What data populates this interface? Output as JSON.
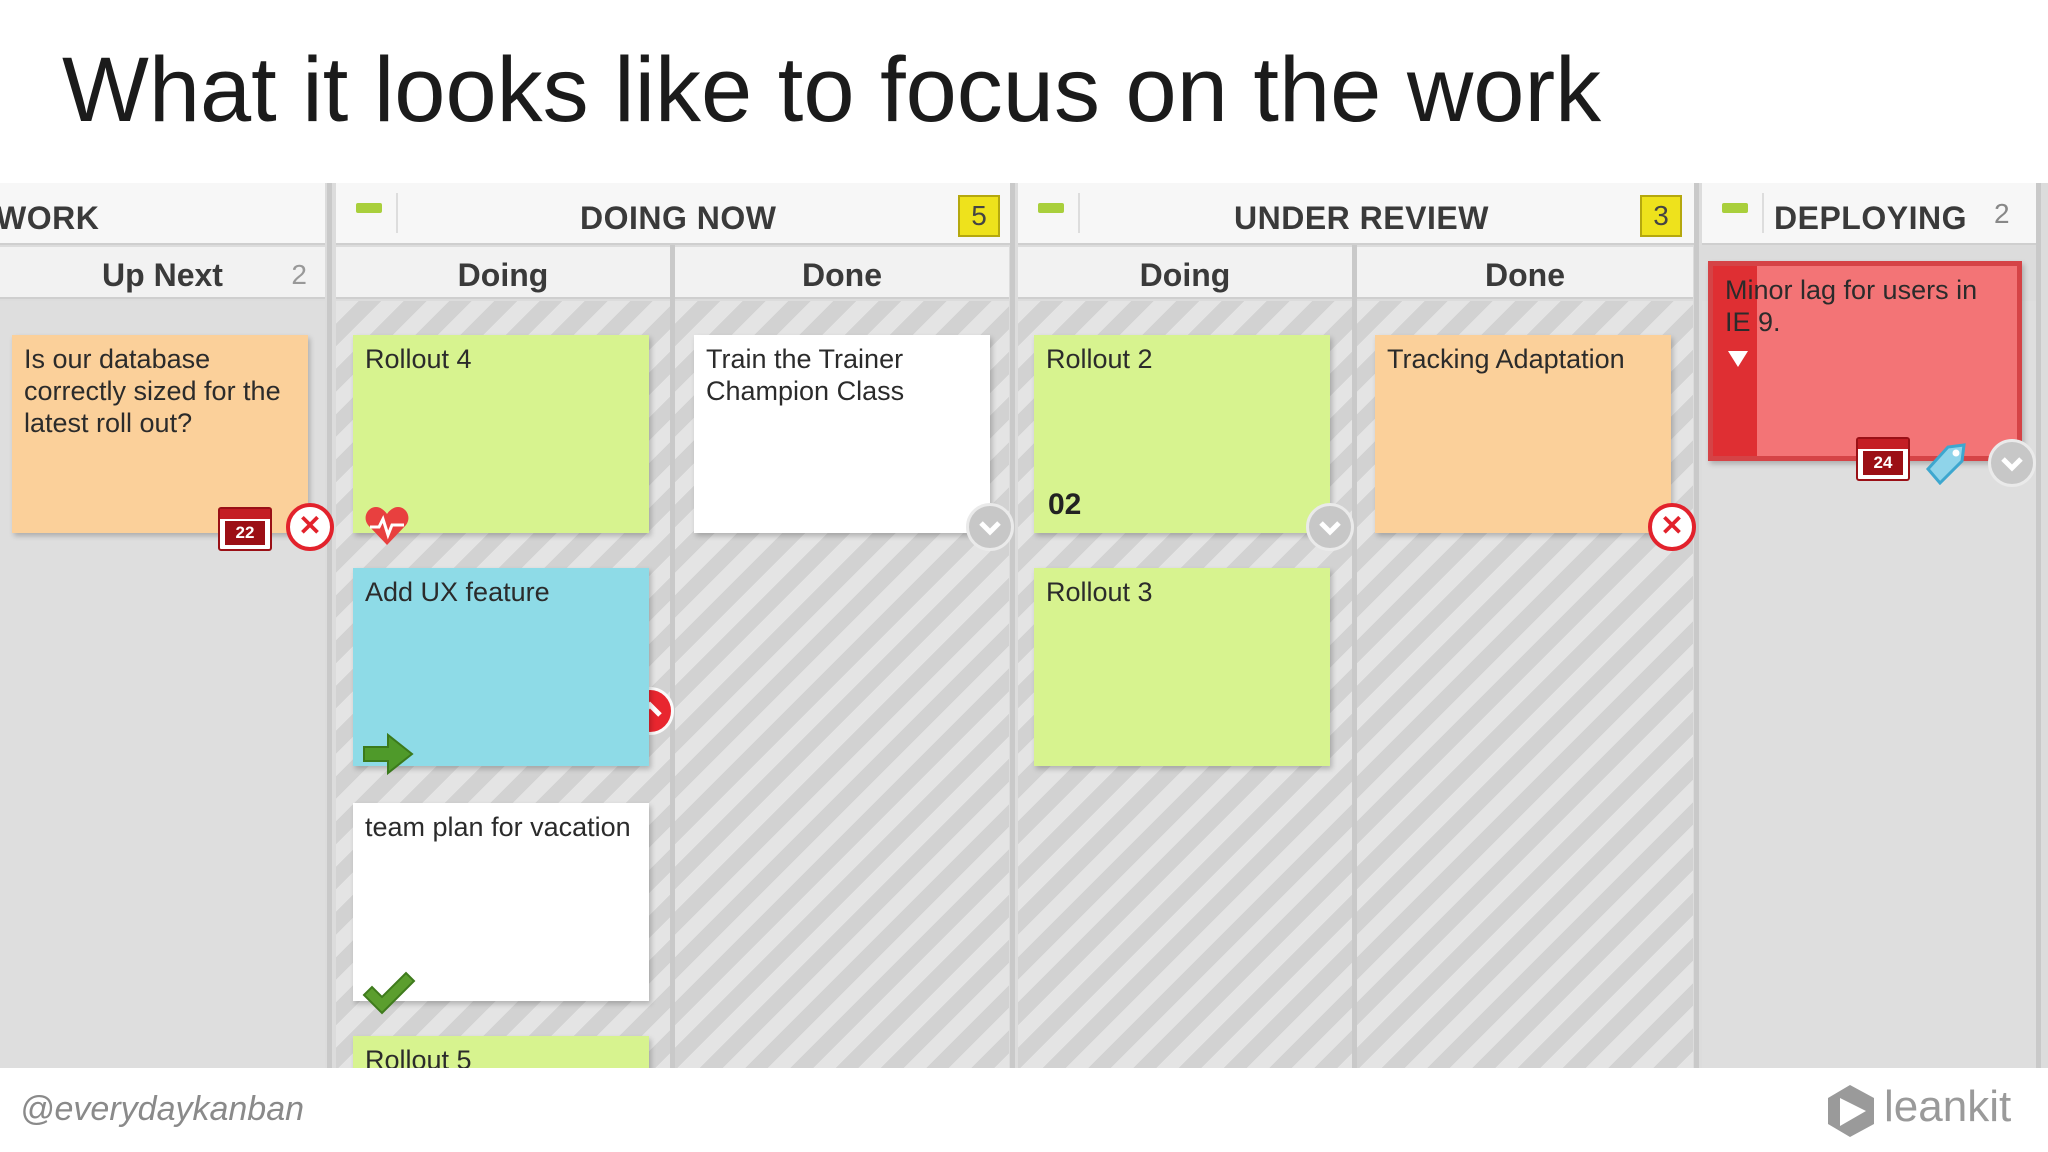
{
  "slide": {
    "title": "What it looks like to focus on the work"
  },
  "lanes": [
    {
      "title": "WORK",
      "wip": ""
    },
    {
      "title": "DOING NOW",
      "wip": "5"
    },
    {
      "title": "UNDER REVIEW",
      "wip": "3"
    },
    {
      "title": "DEPLOYING",
      "wip": "2"
    }
  ],
  "columns": [
    {
      "title": "Up Next",
      "count": "2"
    },
    {
      "title": "Doing",
      "count": ""
    },
    {
      "title": "Done",
      "count": ""
    },
    {
      "title": "Doing",
      "count": ""
    },
    {
      "title": "Done",
      "count": ""
    }
  ],
  "cards": {
    "database": {
      "text": "Is our database correctly sized for the latest roll out?",
      "date": "22",
      "color": "#fbd09a"
    },
    "rollout4": {
      "text": "Rollout 4",
      "color": "#d7f38f",
      "icons": [
        "heart-icon",
        "tag-icon",
        "chevron-up-icon"
      ]
    },
    "ux": {
      "text": "Add UX feature",
      "color": "#8edbe7",
      "icons": [
        "arrow-right-icon"
      ]
    },
    "vacation": {
      "text": "team plan for vacation",
      "color": "#ffffff",
      "icons": [
        "checkmark-icon"
      ]
    },
    "rollout5": {
      "text": "Rollout 5",
      "color": "#d7f38f"
    },
    "trainer": {
      "text": "Train the Trainer Champion Class",
      "color": "#ffffff"
    },
    "rollout2": {
      "text": "Rollout 2",
      "number": "02",
      "color": "#d7f38f"
    },
    "rollout3": {
      "text": "Rollout 3",
      "color": "#d7f38f"
    },
    "tracking": {
      "text": "Tracking Adaptation",
      "color": "#fbd09a"
    },
    "ie9": {
      "text": "Minor lag for users in IE 9.",
      "date": "24",
      "color": "#f37476"
    }
  },
  "footer": {
    "handle": "@everydaykanban",
    "brand": "leankit"
  },
  "colors": {
    "accent_green": "#a9cf3c",
    "wip_yellow": "#eee21c",
    "blocked_red": "#e2222c"
  }
}
